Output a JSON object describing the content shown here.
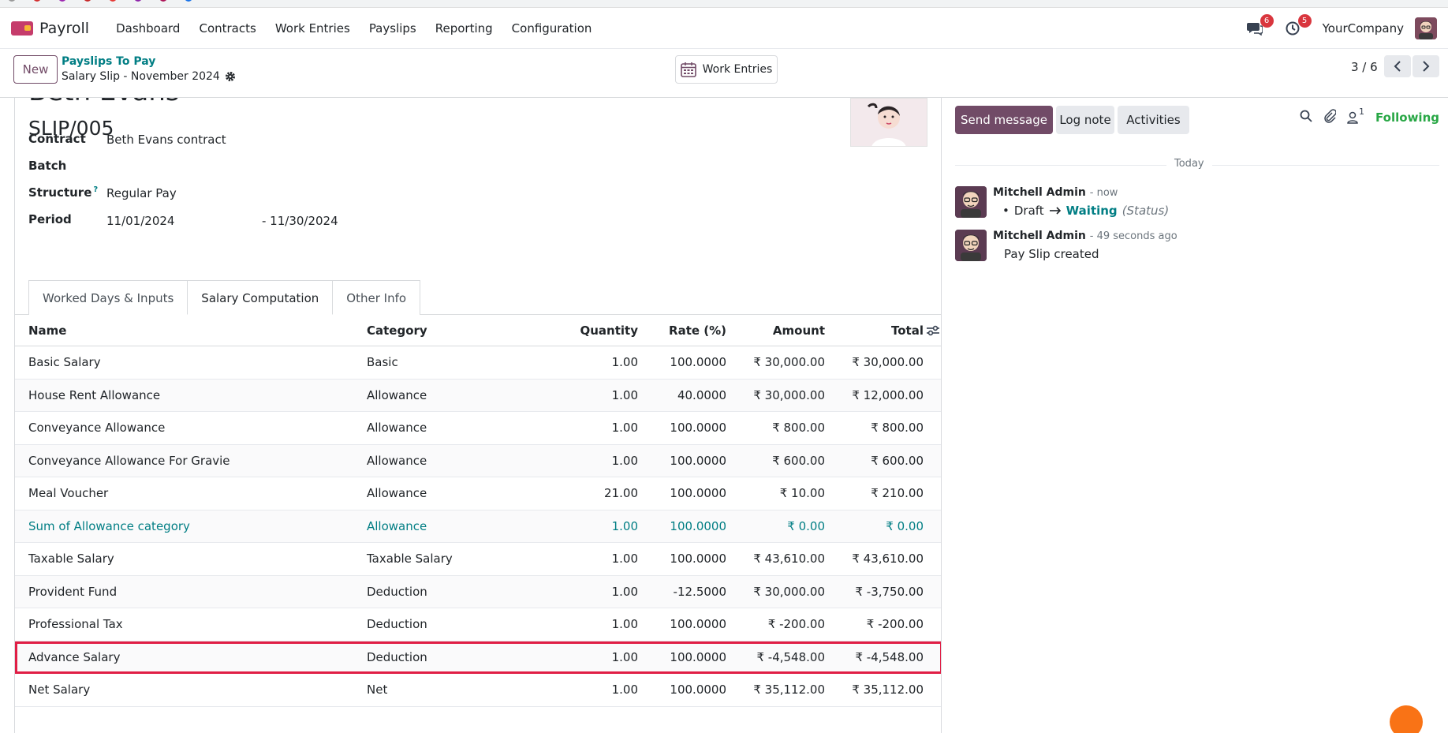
{
  "navbar": {
    "app_name": "Payroll",
    "menu": [
      "Dashboard",
      "Contracts",
      "Work Entries",
      "Payslips",
      "Reporting",
      "Configuration"
    ],
    "messages_badge": "6",
    "activities_badge": "5",
    "company": "YourCompany"
  },
  "control": {
    "new_label": "New",
    "breadcrumb": "Payslips To Pay",
    "record_name": "Salary Slip - November 2024",
    "work_entries_label": "Work Entries",
    "pager": "3 / 6"
  },
  "form": {
    "employee_name": "Beth Evans",
    "reference": "SLIP/005",
    "fields": {
      "contract_label": "Contract",
      "contract_value": "Beth Evans  contract",
      "batch_label": "Batch",
      "batch_value": "",
      "structure_label": "Structure",
      "structure_help": "?",
      "structure_value": "Regular Pay",
      "period_label": "Period",
      "period_from": "11/01/2024",
      "period_to": "- 11/30/2024"
    },
    "tabs": [
      "Worked Days & Inputs",
      "Salary Computation",
      "Other Info"
    ],
    "active_tab": "Salary Computation"
  },
  "table": {
    "headers": {
      "name": "Name",
      "category": "Category",
      "quantity": "Quantity",
      "rate": "Rate (%)",
      "amount": "Amount",
      "total": "Total"
    },
    "rows": [
      {
        "name": "Basic Salary",
        "category": "Basic",
        "quantity": "1.00",
        "rate": "100.0000",
        "amount": "₹ 30,000.00",
        "total": "₹ 30,000.00"
      },
      {
        "name": "House Rent Allowance",
        "category": "Allowance",
        "quantity": "1.00",
        "rate": "40.0000",
        "amount": "₹ 30,000.00",
        "total": "₹ 12,000.00"
      },
      {
        "name": "Conveyance Allowance",
        "category": "Allowance",
        "quantity": "1.00",
        "rate": "100.0000",
        "amount": "₹ 800.00",
        "total": "₹ 800.00"
      },
      {
        "name": "Conveyance Allowance For Gravie",
        "category": "Allowance",
        "quantity": "1.00",
        "rate": "100.0000",
        "amount": "₹ 600.00",
        "total": "₹ 600.00"
      },
      {
        "name": "Meal Voucher",
        "category": "Allowance",
        "quantity": "21.00",
        "rate": "100.0000",
        "amount": "₹ 10.00",
        "total": "₹ 210.00"
      },
      {
        "name": "Sum of Allowance category",
        "category": "Allowance",
        "quantity": "1.00",
        "rate": "100.0000",
        "amount": "₹ 0.00",
        "total": "₹ 0.00"
      },
      {
        "name": "Taxable Salary",
        "category": "Taxable Salary",
        "quantity": "1.00",
        "rate": "100.0000",
        "amount": "₹ 43,610.00",
        "total": "₹ 43,610.00"
      },
      {
        "name": "Provident Fund",
        "category": "Deduction",
        "quantity": "1.00",
        "rate": "-12.5000",
        "amount": "₹ 30,000.00",
        "total": "₹ -3,750.00"
      },
      {
        "name": "Professional Tax",
        "category": "Deduction",
        "quantity": "1.00",
        "rate": "100.0000",
        "amount": "₹ -200.00",
        "total": "₹ -200.00"
      },
      {
        "name": "Advance Salary",
        "category": "Deduction",
        "quantity": "1.00",
        "rate": "100.0000",
        "amount": "₹ -4,548.00",
        "total": "₹ -4,548.00"
      },
      {
        "name": "Net Salary",
        "category": "Net",
        "quantity": "1.00",
        "rate": "100.0000",
        "amount": "₹ 35,112.00",
        "total": "₹ 35,112.00"
      }
    ]
  },
  "chatter": {
    "send_message": "Send message",
    "log_note": "Log note",
    "activities": "Activities",
    "followers_count": "1",
    "following": "Following",
    "today": "Today",
    "messages": [
      {
        "author": "Mitchell Admin",
        "time": "- now",
        "old_value": "Draft",
        "new_value": "Waiting",
        "field": "(Status)"
      },
      {
        "author": "Mitchell Admin",
        "time": "- 49 seconds ago",
        "body": "Pay Slip created"
      }
    ]
  },
  "colors": {
    "primary": "#714b67",
    "link": "#017e84",
    "highlight": "#e01e45",
    "success": "#28a745"
  }
}
